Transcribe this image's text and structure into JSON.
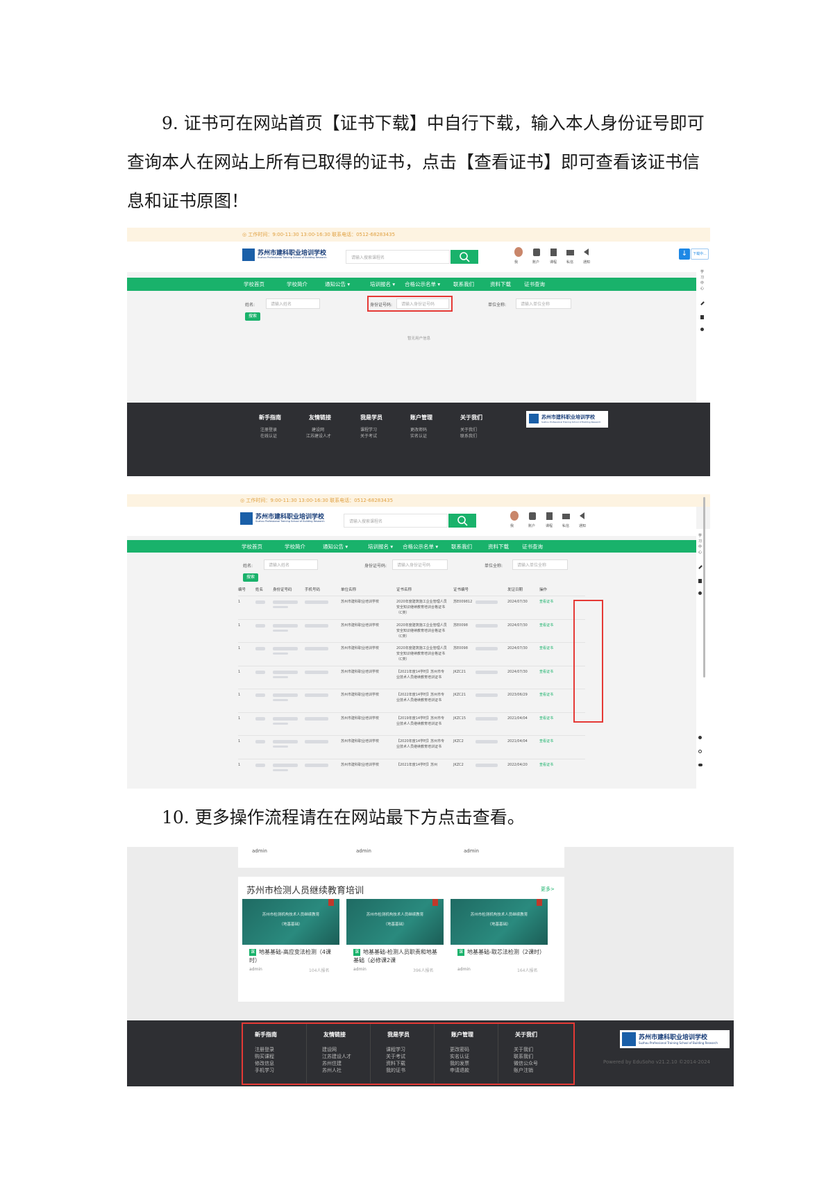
{
  "intro": {
    "p9": "9. 证书可在网站首页【证书下载】中自行下载，输入本人身份证号即可查询本人在网站上所有已取得的证书，点击【查看证书】即可查看该证书信息和证书原图！",
    "p10": "10. 更多操作流程请在在网站最下方点击查看。"
  },
  "site": {
    "topbar": "◎ 工作时间：9:00-11:30 13:00-16:30 联系电话：0512-68283435",
    "school_name": "苏州市建科职业培训学校",
    "school_en": "Suzhou Professional Training School of Building Research",
    "search_placeholder": "请输入搜索课程名",
    "user_icons": [
      "我",
      "账户",
      "课程",
      "私信",
      "通知"
    ],
    "download_btn": "下载中...",
    "nav": [
      "学校首页",
      "学校简介",
      "通知公告 ▾",
      "培训报名 ▾",
      "合格公示名单 ▾",
      "联系我们",
      "资料下载",
      "证书查询"
    ],
    "form": {
      "name_label": "姓名:",
      "name_ph": "请输入姓名",
      "id_label": "身份证号码:",
      "id_ph": "请输入身份证号码",
      "unit_label": "单位全称:",
      "unit_ph": "请输入单位全称",
      "query_btn": "搜索"
    },
    "empty": "暂无用户信息",
    "side_tools": [
      "学",
      "习",
      "中",
      "心"
    ]
  },
  "footer1": {
    "columns": [
      {
        "title": "新手指南",
        "links": [
          "注册登录",
          "在线认证"
        ]
      },
      {
        "title": "友情链接",
        "links": [
          "建设网",
          "江苏建设人才"
        ]
      },
      {
        "title": "我是学员",
        "links": [
          "课程学习",
          "关于考试"
        ]
      },
      {
        "title": "账户管理",
        "links": [
          "更改密码",
          "实名认证"
        ]
      },
      {
        "title": "关于我们",
        "links": [
          "关于我们",
          "联系我们"
        ]
      }
    ]
  },
  "table": {
    "headers": [
      "编号",
      "姓名",
      "身份证号码",
      "手机号码",
      "单位名称",
      "证书名称",
      "证书编号",
      "发证日期",
      "操作"
    ],
    "rows": [
      {
        "no": "1",
        "unit": "苏州市建科职业培训学校",
        "cert": "2020年度建筑施工企业管理人员安全知识继续教育培训合格证书（C类）",
        "code": "苏E009812",
        "date": "2024/07/30",
        "op": "查看证书"
      },
      {
        "no": "1",
        "unit": "苏州市建科职业培训学校",
        "cert": "2020年度建筑施工企业管理人员安全知识继续教育培训合格证书（C类）",
        "code": "苏E0098",
        "date": "2024/07/30",
        "op": "查看证书"
      },
      {
        "no": "1",
        "unit": "苏州市建科职业培训学校",
        "cert": "2020年度建筑施工企业管理人员安全知识继续教育培训合格证书（C类）",
        "code": "苏E0098",
        "date": "2024/07/30",
        "op": "查看证书"
      },
      {
        "no": "1",
        "unit": "苏州市建科职业培训学校",
        "cert": "【2021年度14学时】苏州市专业技术人员继续教育培训证书",
        "code": "JKZC21",
        "date": "2024/07/30",
        "op": "查看证书"
      },
      {
        "no": "1",
        "unit": "苏州市建科职业培训学校",
        "cert": "【2022年度14学时】苏州市专业技术人员继续教育培训证书",
        "code": "JKZC21",
        "date": "2023/06/29",
        "op": "查看证书"
      },
      {
        "no": "1",
        "unit": "苏州市建科职业培训学校",
        "cert": "【2019年度14学时】苏州市专业技术人员继续教育培训证书",
        "code": "JKZC15",
        "date": "2021/04/04",
        "op": "查看证书"
      },
      {
        "no": "1",
        "unit": "苏州市建科职业培训学校",
        "cert": "【2020年度14学时】苏州市专业技术人员继续教育培训证书",
        "code": "JKZC2",
        "date": "2021/04/04",
        "op": "查看证书"
      },
      {
        "no": "1",
        "unit": "苏州市建科职业培训学校",
        "cert": "【2021年度14学时】苏州",
        "code": "JKZC2",
        "date": "2022/04/20",
        "op": "查看证书"
      }
    ]
  },
  "section3": {
    "top_row": [
      "admin",
      "admin",
      "admin"
    ],
    "title": "苏州市检测人员继续教育培训",
    "more": "更多>",
    "thumb_text": [
      "苏州市检测机构技术人员继续教育",
      "（地基基础）"
    ],
    "courses": [
      {
        "tag": "课",
        "name": "地基基础-高应变法检测（4课时）",
        "author": "admin",
        "count": "104人报名"
      },
      {
        "tag": "课",
        "name": "地基基础-检测人员职责和地基基础（必修课2课",
        "author": "admin",
        "count": "396人报名"
      },
      {
        "tag": "课",
        "name": "地基基础-取芯法检测（2课时）",
        "author": "admin",
        "count": "164人报名"
      }
    ]
  },
  "footer2": {
    "columns": [
      {
        "title": "新手指南",
        "links": [
          "注册登录",
          "购买课程",
          "修改信息",
          "手机学习"
        ]
      },
      {
        "title": "友情链接",
        "links": [
          "建设网",
          "江苏建设人才",
          "苏州住建",
          "苏州人社"
        ]
      },
      {
        "title": "我是学员",
        "links": [
          "课程学习",
          "关于考试",
          "资料下载",
          "我的证书"
        ]
      },
      {
        "title": "账户管理",
        "links": [
          "更改密码",
          "实名认证",
          "我的发票",
          "申请退款"
        ]
      },
      {
        "title": "关于我们",
        "links": [
          "关于我们",
          "联系我们",
          "微信公众号",
          "账户注销"
        ]
      }
    ],
    "powered": "Powered by EduSoho v21.2.10 ©2014-2024"
  }
}
